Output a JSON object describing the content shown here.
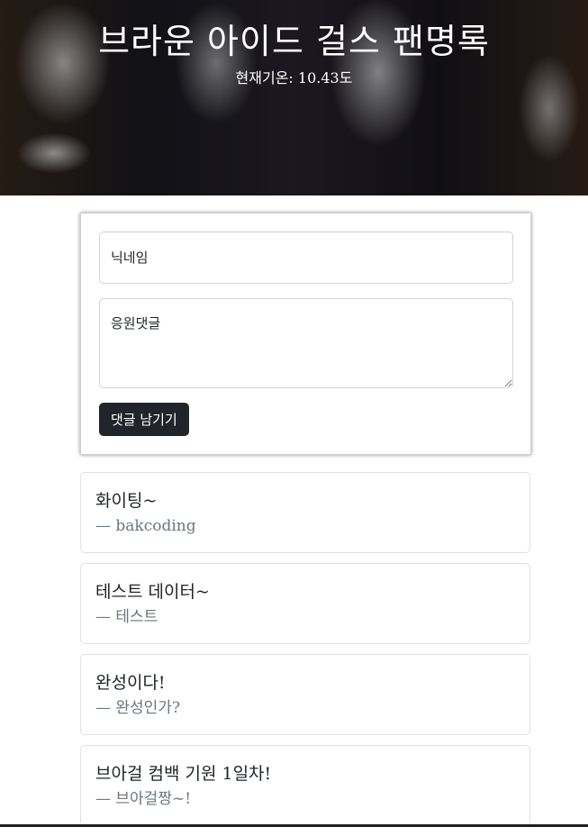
{
  "header": {
    "title": "브라운 아이드 걸스 팬명록",
    "temperature": "현재기온: 10.43도"
  },
  "form": {
    "nickname_placeholder": "닉네임",
    "comment_placeholder": "응원댓글",
    "submit_label": "댓글 남기기"
  },
  "comments": [
    {
      "text": "화이팅~",
      "author": "— bakcoding"
    },
    {
      "text": "테스트 데이터~",
      "author": "— 테스트"
    },
    {
      "text": "완성이다!",
      "author": "— 완성인가?"
    },
    {
      "text": "브아걸 컴백 기원 1일차!",
      "author": "— 브아걸짱~!"
    }
  ]
}
